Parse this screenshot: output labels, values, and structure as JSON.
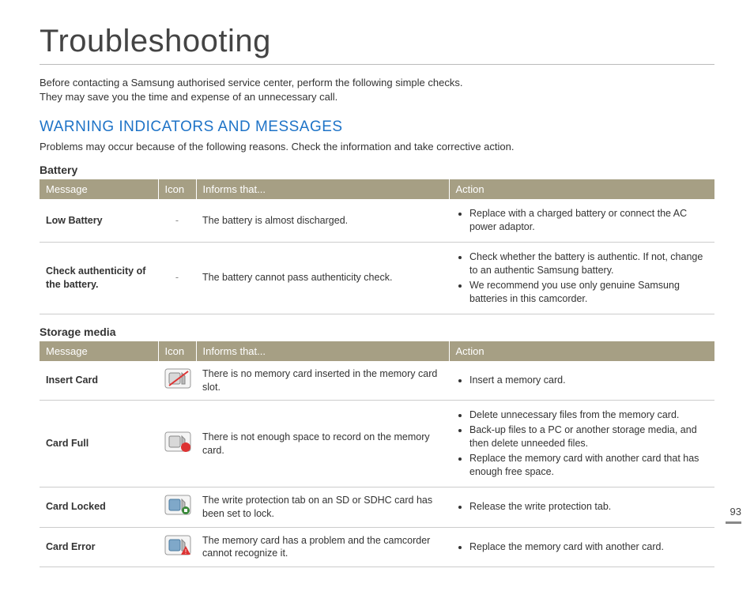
{
  "page": {
    "title": "Troubleshooting",
    "intro_line1": "Before contacting a Samsung authorised service center, perform the following simple checks.",
    "intro_line2": "They may save you the time and expense of an unnecessary call.",
    "number": "93"
  },
  "section": {
    "heading": "WARNING INDICATORS AND MESSAGES",
    "lead": "Problems may occur because of the following reasons. Check the information and take corrective action."
  },
  "headers": {
    "message": "Message",
    "icon": "Icon",
    "informs": "Informs that...",
    "action": "Action"
  },
  "battery": {
    "title": "Battery",
    "rows": [
      {
        "message": "Low Battery",
        "icon": "-",
        "informs": "The battery is almost discharged.",
        "actions": [
          "Replace with a charged battery or connect the AC power adaptor."
        ]
      },
      {
        "message": "Check authenticity of the battery.",
        "icon": "-",
        "informs": "The battery cannot pass authenticity check.",
        "actions": [
          "Check whether the battery is authentic. If not, change to an authentic Samsung battery.",
          "We recommend you use only genuine Samsung batteries in this camcorder."
        ]
      }
    ]
  },
  "storage": {
    "title": "Storage media",
    "rows": [
      {
        "message": "Insert Card",
        "icon": "card-insert-icon",
        "informs": "There is no memory card inserted in the memory card slot.",
        "actions": [
          "Insert a memory card."
        ]
      },
      {
        "message": "Card Full",
        "icon": "card-full-icon",
        "informs": "There is not enough space to record on the memory card.",
        "actions": [
          "Delete unnecessary files from the memory card.",
          "Back-up files to a PC or another storage media, and then delete unneeded files.",
          "Replace the memory card with another card that has enough free space."
        ]
      },
      {
        "message": "Card Locked",
        "icon": "card-locked-icon",
        "informs": "The write protection tab on an SD or SDHC card has been set to lock.",
        "actions": [
          "Release the write protection tab."
        ]
      },
      {
        "message": "Card Error",
        "icon": "card-error-icon",
        "informs": "The memory card has a problem and the camcorder cannot recognize it.",
        "actions": [
          "Replace the memory card with another card."
        ]
      }
    ]
  }
}
